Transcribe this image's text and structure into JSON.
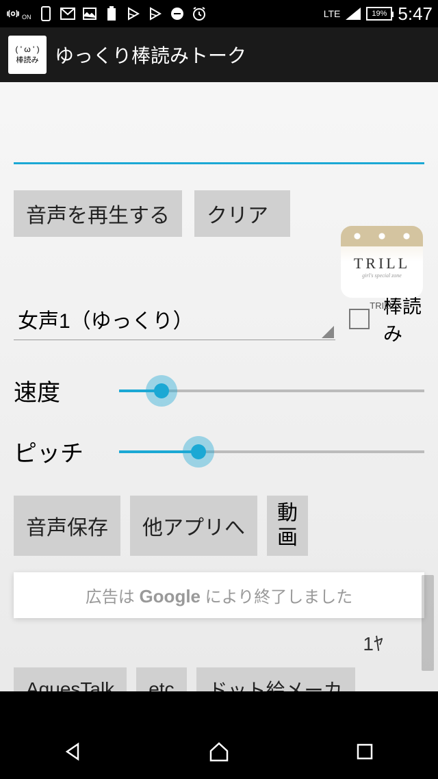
{
  "status": {
    "network": "LTE",
    "battery": "19%",
    "time": "5:47"
  },
  "app": {
    "icon_face": "( ' ω ' )",
    "icon_text": "棒読み",
    "title": "ゆっくり棒読みトーク"
  },
  "buttons": {
    "play": "音声を再生する",
    "clear": "クリア",
    "save": "音声保存",
    "other_apps": "他アプリへ",
    "video": "動画",
    "partial": "1ﾔ",
    "aquestalk": "AquesTalk",
    "etc": "etc",
    "dotmaker": "ドット絵メーカ"
  },
  "voice": {
    "selected": "女声1（ゆっくり）",
    "checkbox_label": "棒読み"
  },
  "sliders": {
    "speed_label": "速度",
    "speed_value": 14,
    "pitch_label": "ピッチ",
    "pitch_value": 26
  },
  "ads": {
    "trill_name": "TRILL",
    "trill_tag": "girl's special zone",
    "trill_caption": "TRILL",
    "google_closed_pre": "広告は ",
    "google_brand": "Google",
    "google_closed_post": " により終了しました"
  }
}
